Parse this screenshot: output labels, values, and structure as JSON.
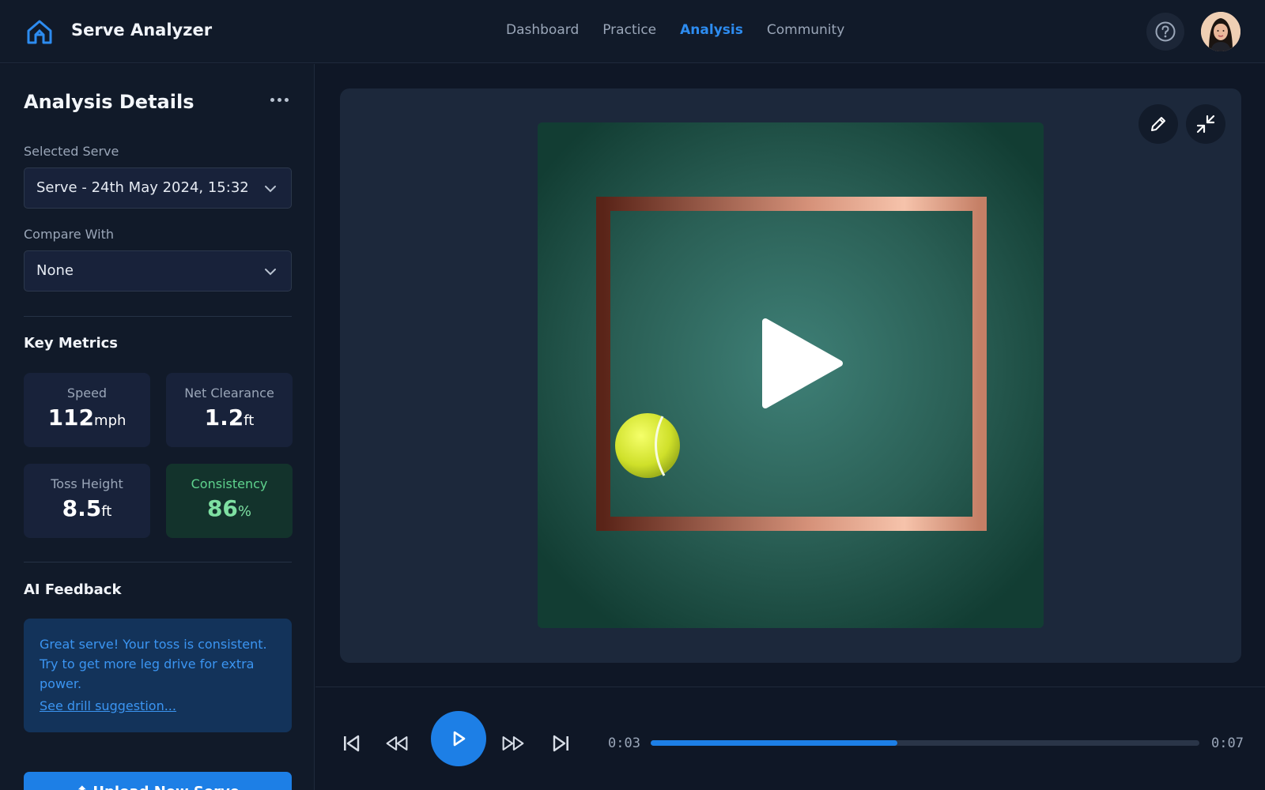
{
  "app": {
    "brand": "Serve Analyzer"
  },
  "nav": [
    {
      "label": "Dashboard",
      "active": false
    },
    {
      "label": "Practice",
      "active": false
    },
    {
      "label": "Analysis",
      "active": true
    },
    {
      "label": "Community",
      "active": false
    }
  ],
  "icons": {
    "logo": "home-icon",
    "help": "help-circle-icon",
    "more": "more-dots-icon",
    "edit": "pencil-icon",
    "collapse": "collapse-arrows-icon",
    "skip_back": "skip-back-icon",
    "rewind": "rewind-icon",
    "play": "play-icon",
    "forward": "fast-forward-icon",
    "skip_forward": "skip-forward-icon"
  },
  "sidebar": {
    "title": "Analysis Details",
    "selected_serve_label": "Selected Serve",
    "selected_serve_value": "Serve - 24th May 2024, 15:32",
    "compare_label": "Compare With",
    "compare_value": "None",
    "metrics_title": "Key Metrics",
    "metrics": [
      {
        "label": "Speed",
        "value": "112",
        "unit": "mph"
      },
      {
        "label": "Net Clearance",
        "value": "1.2",
        "unit": "ft"
      },
      {
        "label": "Toss Height",
        "value": "8.5",
        "unit": "ft"
      },
      {
        "label": "Consistency",
        "value": "86",
        "unit": "%"
      }
    ],
    "feedback_title": "AI Feedback",
    "feedback_text": "Great serve! Your toss is consistent. Try to get more leg drive for extra power.",
    "feedback_link": "See drill suggestion...",
    "upload_label": "⬆ Upload New Serve"
  },
  "player": {
    "current_time": "0:03",
    "total_time": "0:07",
    "progress": 0.45
  },
  "colors": {
    "accent": "#1d7fe6",
    "success": "#7ee0a2",
    "background": "#0f1726"
  }
}
